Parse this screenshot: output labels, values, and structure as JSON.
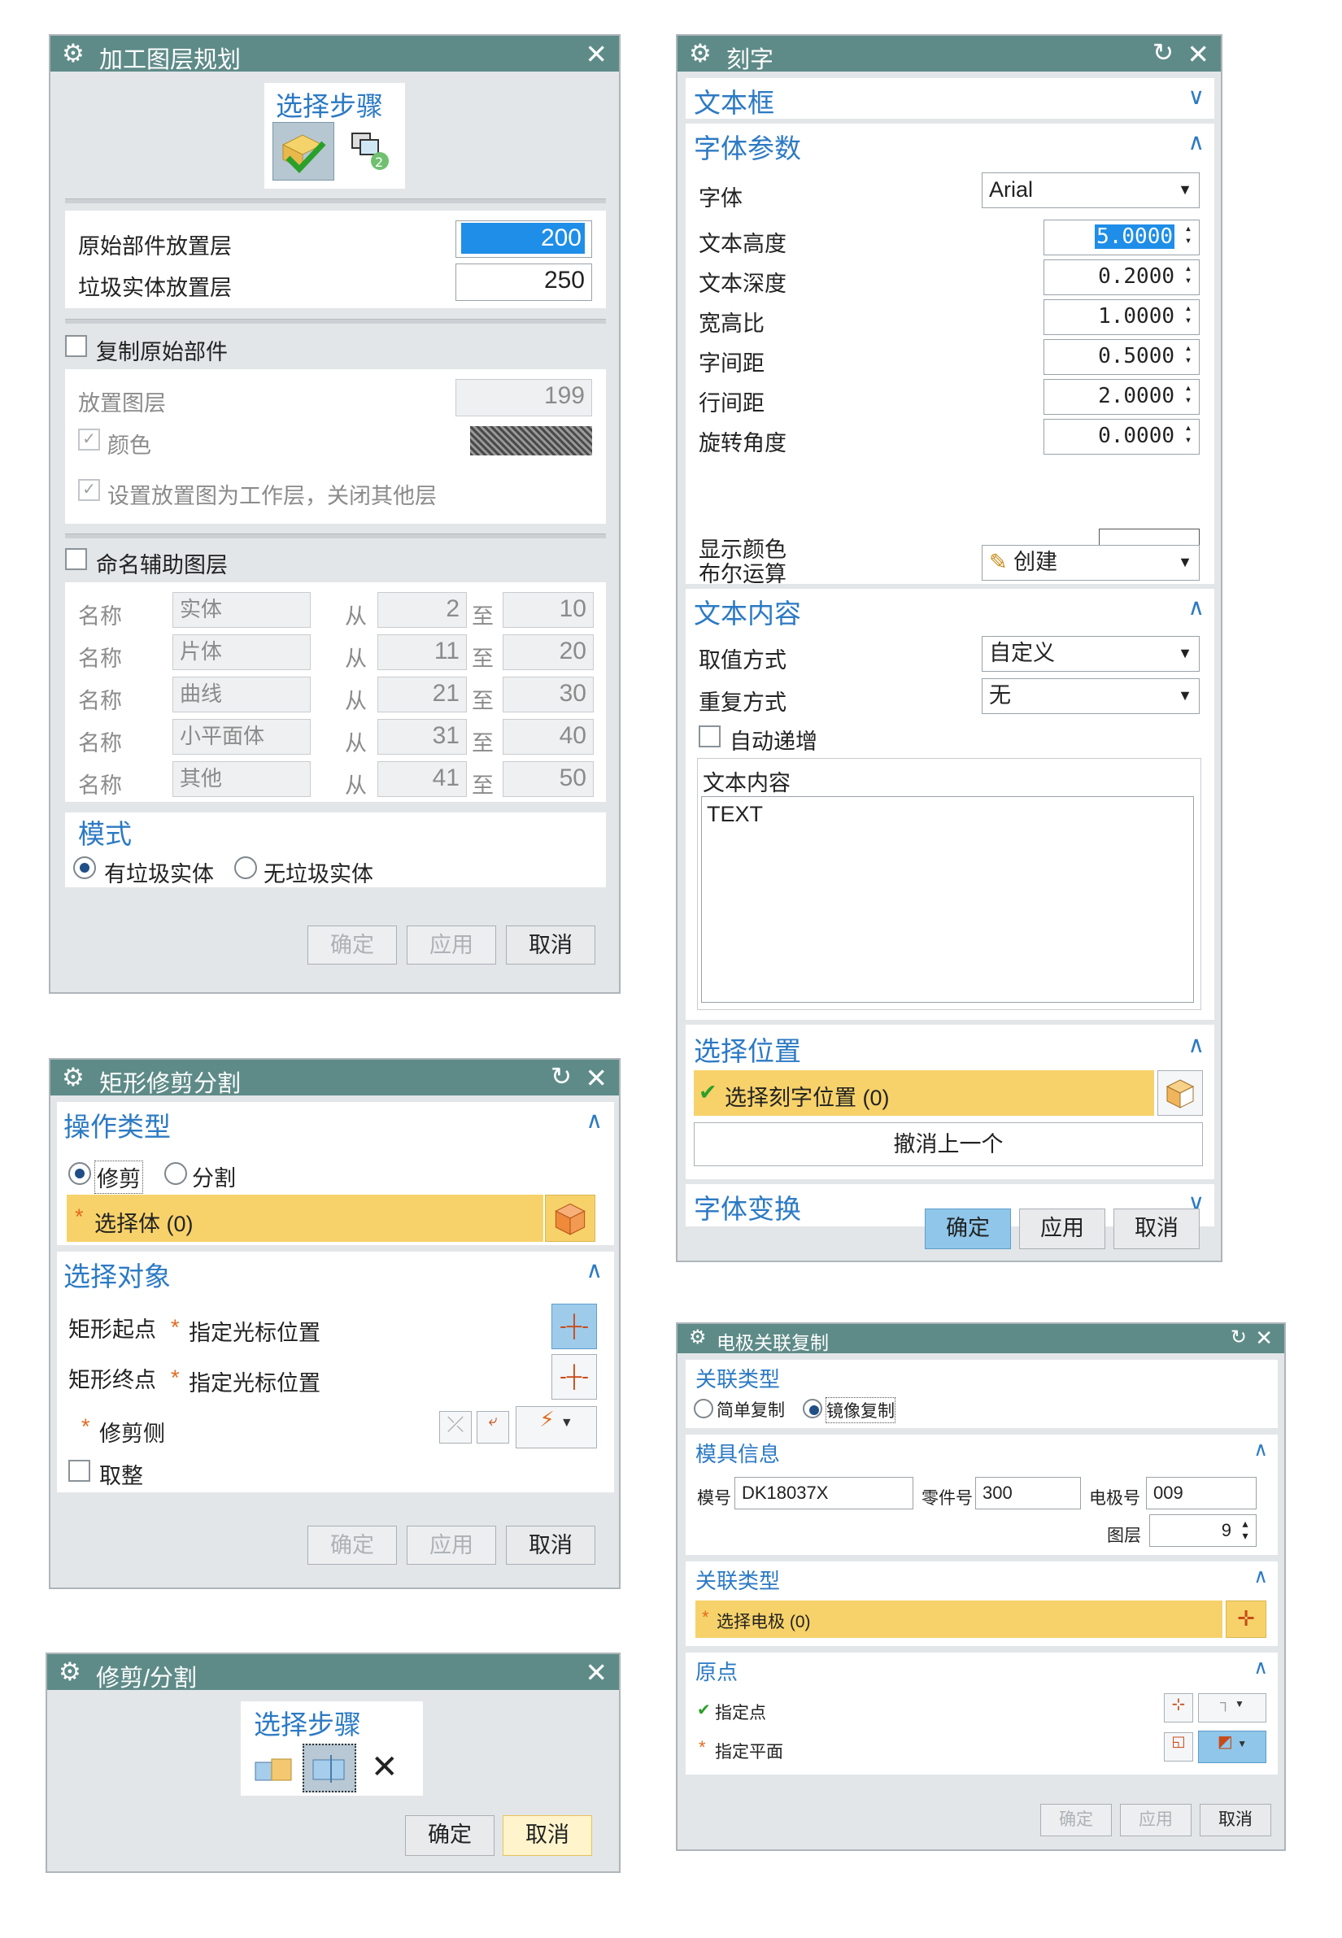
{
  "d1": {
    "title": "加工图层规划",
    "steps_label": "选择步骤",
    "orig_layer_label": "原始部件放置层",
    "orig_layer_value": "200",
    "trash_layer_label": "垃圾实体放置层",
    "trash_layer_value": "250",
    "copy_orig_label": "复制原始部件",
    "place_layer_label": "放置图层",
    "place_layer_value": "199",
    "color_label": "颜色",
    "set_work_label": "设置放置图为工作层，关闭其他层",
    "name_aux_label": "命名辅助图层",
    "rows": [
      {
        "name": "名称",
        "val": "实体",
        "from": "从",
        "a": "2",
        "to": "至",
        "b": "10"
      },
      {
        "name": "名称",
        "val": "片体",
        "from": "从",
        "a": "11",
        "to": "至",
        "b": "20"
      },
      {
        "name": "名称",
        "val": "曲线",
        "from": "从",
        "a": "21",
        "to": "至",
        "b": "30"
      },
      {
        "name": "名称",
        "val": "小平面体",
        "from": "从",
        "a": "31",
        "to": "至",
        "b": "40"
      },
      {
        "name": "名称",
        "val": "其他",
        "from": "从",
        "a": "41",
        "to": "至",
        "b": "50"
      }
    ],
    "mode_label": "模式",
    "mode_a": "有垃圾实体",
    "mode_b": "无垃圾实体",
    "ok": "确定",
    "apply": "应用",
    "cancel": "取消"
  },
  "d2": {
    "title": "刻字",
    "sec_frame": "文本框",
    "sec_font": "字体参数",
    "font_label": "字体",
    "font_value": "Arial",
    "params": [
      {
        "label": "文本高度",
        "value": "5.0000"
      },
      {
        "label": "文本深度",
        "value": "0.2000"
      },
      {
        "label": "宽高比",
        "value": "1.0000"
      },
      {
        "label": "字间距",
        "value": "0.5000"
      },
      {
        "label": "行间距",
        "value": "2.0000"
      },
      {
        "label": "旋转角度",
        "value": "0.0000"
      }
    ],
    "show_color_label": "显示颜色",
    "bool_label": "布尔运算",
    "bool_value": "创建",
    "sec_content": "文本内容",
    "value_mode_label": "取值方式",
    "value_mode": "自定义",
    "repeat_label": "重复方式",
    "repeat_value": "无",
    "auto_inc_label": "自动递增",
    "content_label": "文本内容",
    "content_text": "TEXT",
    "sec_position": "选择位置",
    "select_pos": "选择刻字位置 (0)",
    "undo_last": "撤消上一个",
    "sec_transform": "字体变换",
    "ok": "确定",
    "apply": "应用",
    "cancel": "取消"
  },
  "d3": {
    "title": "矩形修剪分割",
    "sec_op": "操作类型",
    "op_trim": "修剪",
    "op_split": "分割",
    "select_body": "选择体 (0)",
    "sec_obj": "选择对象",
    "rect_start": "矩形起点",
    "rect_end": "矩形终点",
    "cursor_pos": "指定光标位置",
    "trim_side": "修剪侧",
    "round_label": "取整",
    "ok": "确定",
    "apply": "应用",
    "cancel": "取消"
  },
  "d4": {
    "title": "修剪/分割",
    "steps_label": "选择步骤",
    "ok": "确定",
    "cancel": "取消"
  },
  "d5": {
    "title": "电极关联复制",
    "sec_type": "关联类型",
    "simple_copy": "简单复制",
    "mirror_copy": "镜像复制",
    "sec_mold": "模具信息",
    "mold_no_label": "模号",
    "mold_no": "DK18037X",
    "part_no_label": "零件号",
    "part_no": "300",
    "elec_no_label": "电极号",
    "elec_no": "009",
    "layer_label": "图层",
    "layer_value": "9",
    "sec_type2": "关联类型",
    "select_elec": "选择电极 (0)",
    "sec_origin": "原点",
    "spec_point": "指定点",
    "spec_plane": "指定平面",
    "ok": "确定",
    "apply": "应用",
    "cancel": "取消"
  }
}
